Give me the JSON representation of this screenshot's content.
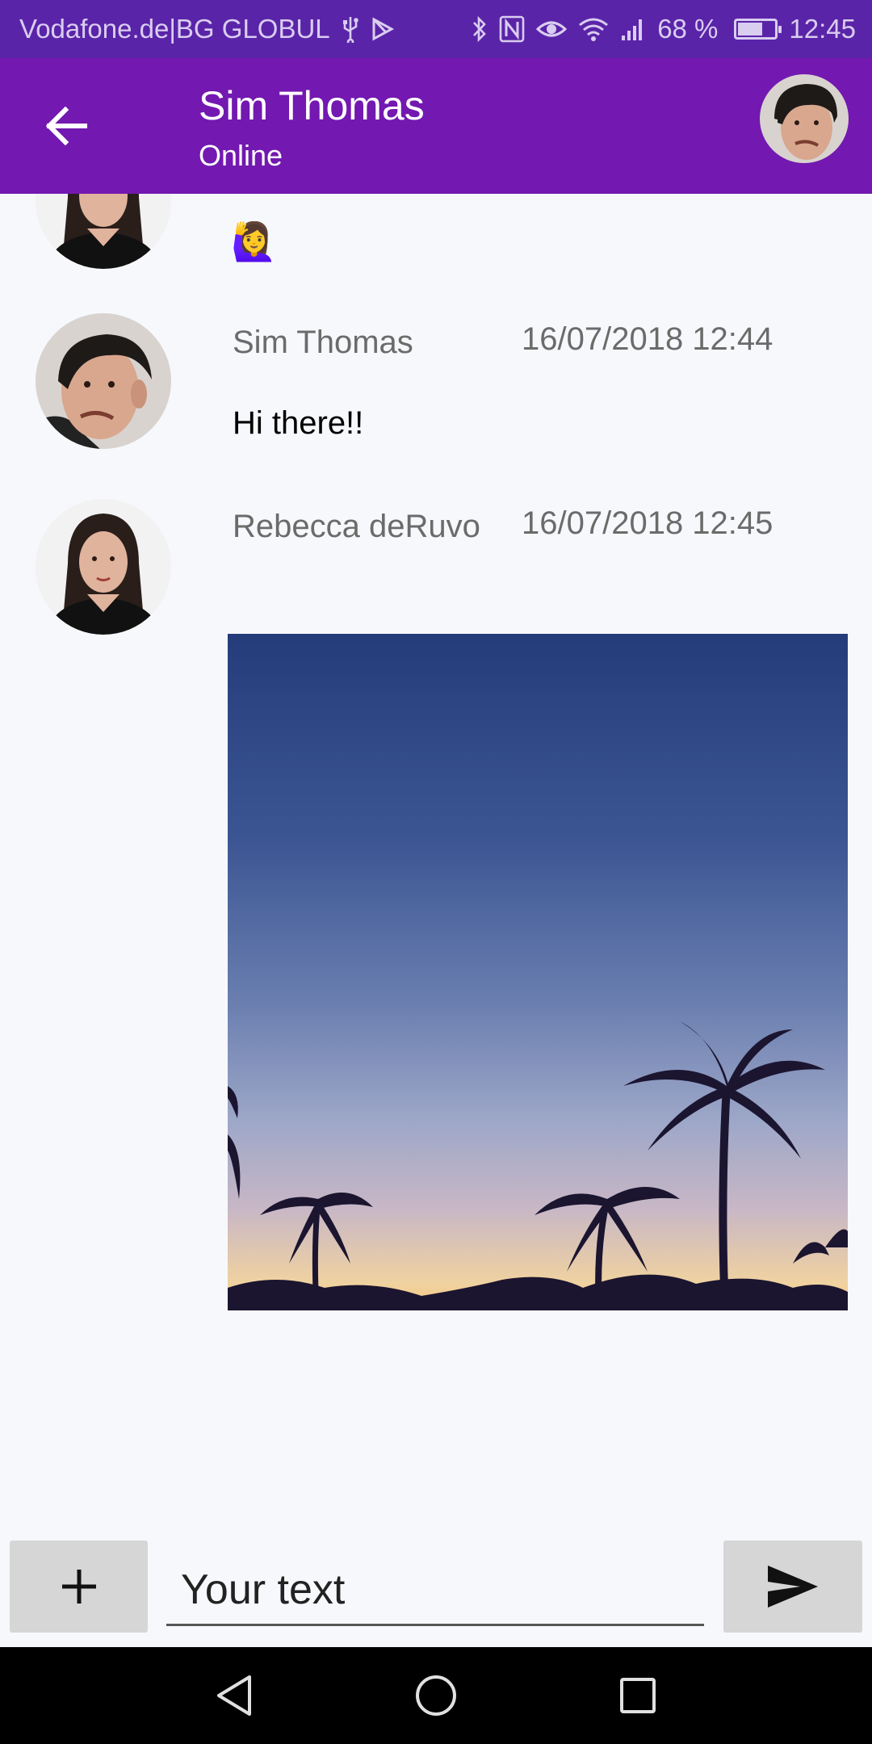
{
  "status_bar": {
    "carrier": "Vodafone.de|BG GLOBUL",
    "battery_text": "68 %",
    "battery_level": 0.68,
    "time": "12:45",
    "icons": [
      "usb-icon",
      "play-store-icon",
      "bluetooth-icon",
      "nfc-icon",
      "eye-icon",
      "wifi-icon",
      "signal-icon",
      "battery-icon"
    ]
  },
  "header": {
    "back_icon": "arrow-left-icon",
    "contact_name": "Sim Thomas",
    "contact_status": "Online"
  },
  "messages": [
    {
      "type": "emoji",
      "author": "Rebecca deRuvo",
      "content": "🙋‍♀️"
    },
    {
      "type": "text",
      "author": "Sim Thomas",
      "time": "16/07/2018 12:44",
      "content": "Hi there!!"
    },
    {
      "type": "image",
      "author": "Rebecca deRuvo",
      "time": "16/07/2018 12:45",
      "content": "palm trees at sunset photo"
    }
  ],
  "input_bar": {
    "attach_icon": "plus-icon",
    "placeholder": "Your text",
    "send_icon": "send-icon"
  },
  "nav_bar": {
    "icons": [
      "back-triangle-icon",
      "home-circle-icon",
      "recents-square-icon"
    ]
  },
  "colors": {
    "status_bar": "#5a24a8",
    "app_bar": "#7318b0",
    "background": "#f7f8fb",
    "button_gray": "#d6d6d6"
  }
}
